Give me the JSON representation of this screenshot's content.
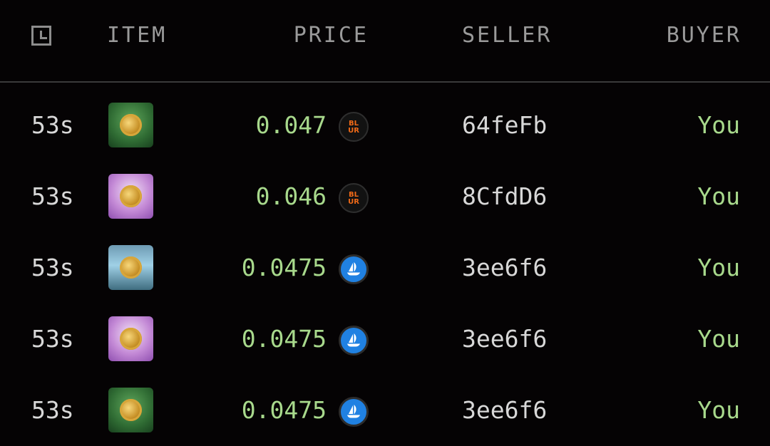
{
  "header": {
    "time_icon": "clock-icon",
    "item": "ITEM",
    "price": "PRICE",
    "seller": "SELLER",
    "buyer": "BUYER"
  },
  "rows": [
    {
      "time": "53s",
      "thumb": "green",
      "price": "0.047",
      "marketplace": "blur",
      "marketplace_label": "BL\nUR",
      "seller": "64feFb",
      "buyer": "You"
    },
    {
      "time": "53s",
      "thumb": "purple",
      "price": "0.046",
      "marketplace": "blur",
      "marketplace_label": "BL\nUR",
      "seller": "8CfdD6",
      "buyer": "You"
    },
    {
      "time": "53s",
      "thumb": "water",
      "price": "0.0475",
      "marketplace": "opensea",
      "seller": "3ee6f6",
      "buyer": "You"
    },
    {
      "time": "53s",
      "thumb": "purple",
      "price": "0.0475",
      "marketplace": "opensea",
      "seller": "3ee6f6",
      "buyer": "You"
    },
    {
      "time": "53s",
      "thumb": "green",
      "price": "0.0475",
      "marketplace": "opensea",
      "seller": "3ee6f6",
      "buyer": "You"
    }
  ],
  "colors": {
    "background": "#050304",
    "price": "#a8d98c",
    "buyer": "#a8d98c",
    "header_text": "#9a9a9a",
    "blur_orange": "#f06a18",
    "opensea_blue": "#2081e2"
  }
}
